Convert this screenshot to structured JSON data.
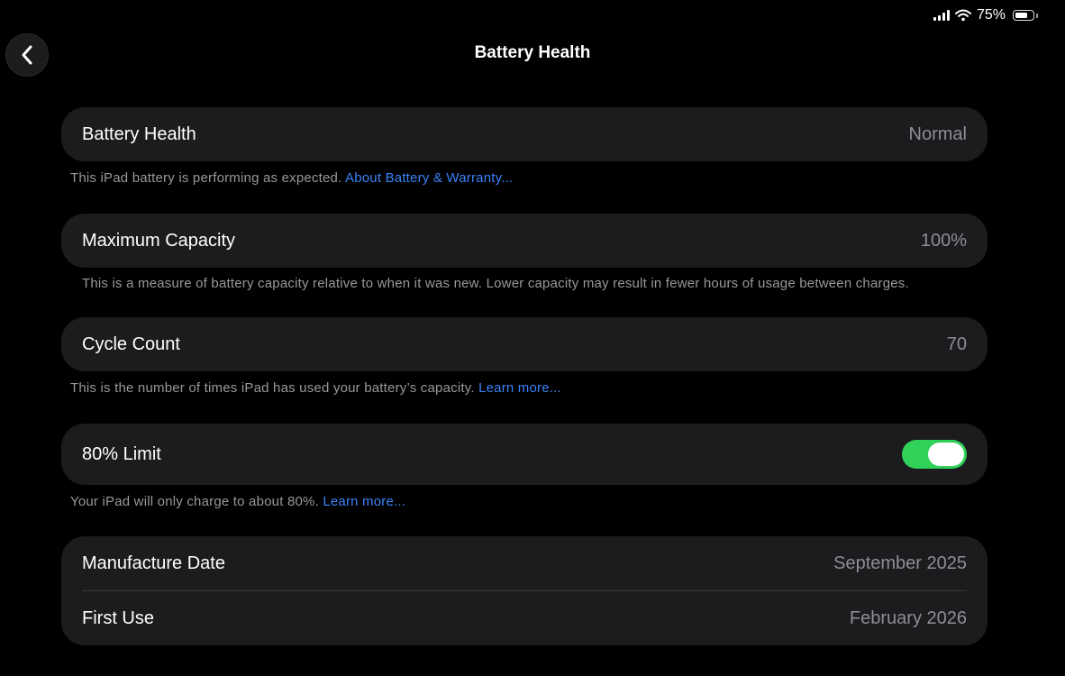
{
  "status_bar": {
    "battery_percent": "75%",
    "battery_level": 0.75
  },
  "header": {
    "title": "Battery Health"
  },
  "battery_health": {
    "label": "Battery Health",
    "value": "Normal",
    "footer_text": "This iPad battery is performing as expected.",
    "footer_link": "About Battery & Warranty..."
  },
  "max_capacity": {
    "label": "Maximum Capacity",
    "value": "100%",
    "footer_text": "This is a measure of battery capacity relative to when it was new. Lower capacity may result in fewer hours of usage between charges."
  },
  "cycle_count": {
    "label": "Cycle Count",
    "value": "70",
    "footer_text": "This is the number of times iPad has used your battery’s capacity.",
    "footer_link": "Learn more..."
  },
  "limit_80": {
    "label": "80% Limit",
    "enabled": true,
    "footer_text": "Your iPad will only charge to about 80%.",
    "footer_link": "Learn more..."
  },
  "dates": {
    "manufacture_label": "Manufacture Date",
    "manufacture_value": "September 2025",
    "first_use_label": "First Use",
    "first_use_value": "February 2026"
  },
  "colors": {
    "accent_link": "#3a82f7",
    "toggle_on": "#30d158",
    "card_bg": "#1c1c1e"
  }
}
